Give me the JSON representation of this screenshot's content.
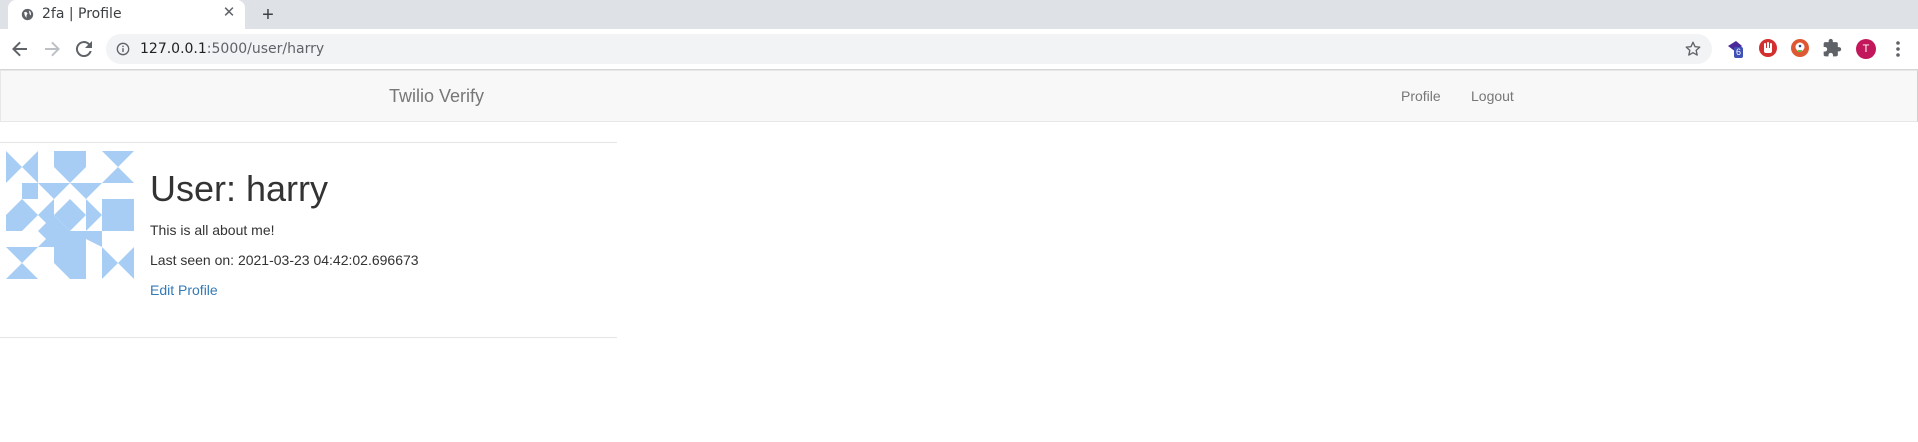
{
  "browser": {
    "tab_title": "2fa | Profile",
    "url_host": "127.0.0.1",
    "url_rest": ":5000/user/harry",
    "extension_badge": "6",
    "profile_initial": "T"
  },
  "navbar": {
    "brand": "Twilio Verify",
    "links": [
      "Profile",
      "Logout"
    ]
  },
  "profile": {
    "title": "User: harry",
    "about_me": "This is all about me!",
    "last_seen": "Last seen on: 2021-03-23 04:42:02.696673",
    "edit_link": "Edit Profile",
    "identicon_color": "#a8cdf5"
  }
}
